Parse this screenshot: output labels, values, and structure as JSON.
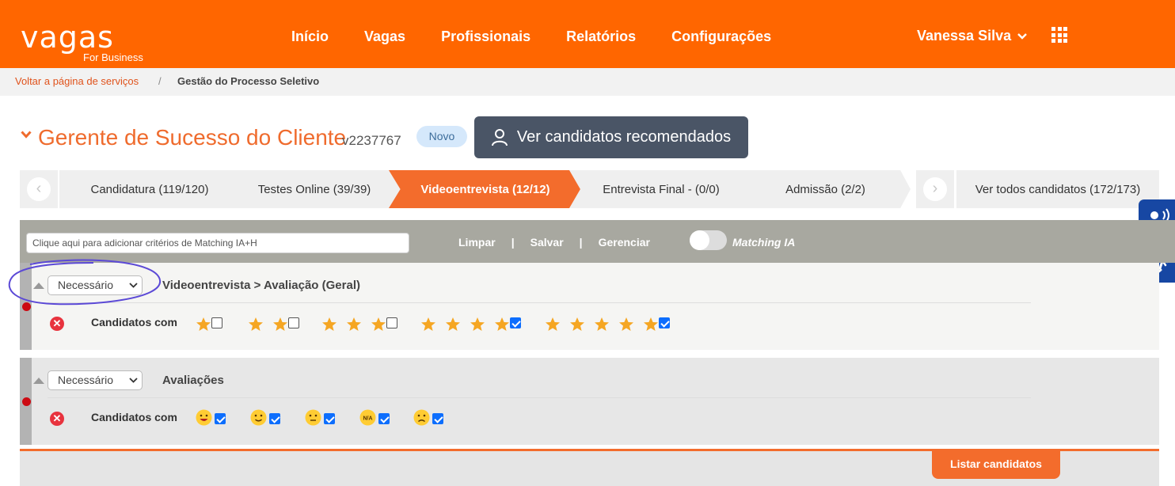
{
  "header": {
    "logo_main": "vagas",
    "logo_sub": "For Business",
    "nav": [
      "Início",
      "Vagas",
      "Profissionais",
      "Relatórios",
      "Configurações"
    ],
    "user_name": "Vanessa Silva",
    "brand_color": "#ff6600"
  },
  "breadcrumb": {
    "back": "Voltar a página de serviços",
    "separator": "/",
    "current": "Gestão do Processo Seletivo"
  },
  "job": {
    "title": "Gerente de Sucesso do Cliente",
    "code": "v2237767",
    "badge": "Novo",
    "recommended_button": "Ver candidatos recomendados"
  },
  "steps": [
    "Candidatura (119/120)",
    "Testes Online (39/39)",
    "Videoentrevista (12/12)",
    "Entrevista Final - (0/0)",
    "Admissão (2/2)"
  ],
  "active_step": "Videoentrevista (12/12)",
  "see_all": "Ver todos candidatos (172/173)",
  "toolbar": {
    "criteria_placeholder": "Clique aqui para adicionar critérios de Matching IA+H",
    "clear": "Limpar",
    "save": "Salvar",
    "manage": "Gerenciar",
    "divider": "|",
    "matching_label": "Matching IA",
    "matching_on": false
  },
  "filters": [
    {
      "select_value": "Necessário",
      "title": "Videoentrevista > Avaliação (Geral)",
      "candidates_label": "Candidatos com",
      "ratings": [
        {
          "stars": 1,
          "checked": false
        },
        {
          "stars": 2,
          "checked": false
        },
        {
          "stars": 3,
          "checked": false
        },
        {
          "stars": 4,
          "checked": true
        },
        {
          "stars": 5,
          "checked": true
        }
      ]
    },
    {
      "select_value": "Necessário",
      "title": "Avaliações",
      "candidates_label": "Candidatos com",
      "faces": [
        {
          "icon": "very-happy-face-icon",
          "checked": true
        },
        {
          "icon": "happy-face-icon",
          "checked": true
        },
        {
          "icon": "neutral-face-icon",
          "checked": true
        },
        {
          "icon": "not-applicable-face-icon",
          "label": "N/A",
          "checked": true
        },
        {
          "icon": "sad-face-icon",
          "checked": true
        }
      ]
    }
  ],
  "list_button": "Listar candidatos",
  "accessibility": [
    "audio-reader-icon",
    "sign-language-icon"
  ]
}
